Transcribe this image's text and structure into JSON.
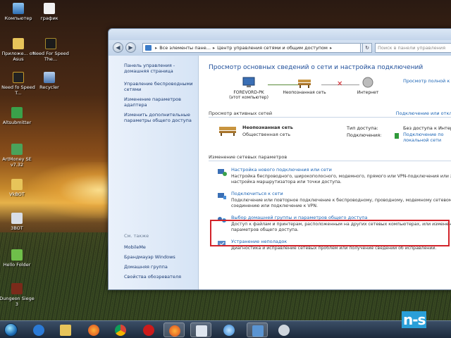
{
  "desktop": {
    "icons": [
      {
        "label": "Компьютер"
      },
      {
        "label": "график"
      },
      {
        "label": "Приложе... от Asus"
      },
      {
        "label": "Need For Speed The..."
      },
      {
        "label": "Need fo Speed T..."
      },
      {
        "label": "Recycler"
      },
      {
        "label": "Altsubmitter"
      },
      {
        "label": "ArtMoney SE v7.32"
      },
      {
        "label": "VkBOT"
      },
      {
        "label": "3BOT"
      },
      {
        "label": "Hello Folder"
      },
      {
        "label": "Dungeon Siege 3"
      }
    ]
  },
  "window": {
    "address": {
      "crumb1": "Все элементы пане...",
      "crumb2": "Центр управления сетями и общим доступом",
      "search_placeholder": "Поиск в панели управления"
    },
    "sidebar": {
      "links": [
        "Панель управления - домашняя страница",
        "Управление беспроводными сетями",
        "Изменение параметров адаптера",
        "Изменить дополнительные параметры общего доступа"
      ],
      "see_also_title": "См. также",
      "see_also": [
        "MobileMe",
        "Брандмауэр Windows",
        "Домашняя группа",
        "Свойства обозревателя"
      ]
    },
    "main": {
      "title": "Просмотр основных сведений о сети и настройка подключений",
      "full_map": "Просмотр полной к",
      "nodes": {
        "computer": "FOREVORD-PK",
        "computer_sub": "(этот компьютер)",
        "network": "Неопознанная сеть",
        "internet": "Интернет"
      },
      "active_section": "Просмотр активных сетей",
      "connect_disconnect": "Подключение или отклю",
      "active_net": {
        "name": "Неопознанная сеть",
        "type": "Общественная сеть",
        "access_type_label": "Тип доступа:",
        "access_type_value": "Без доступа к Интер",
        "connections_label": "Подключения:",
        "connection_value": "Подключение по локальной сети"
      },
      "change_section": "Изменение сетевых параметров",
      "tasks": [
        {
          "title": "Настройка нового подключения или сети",
          "desc": "Настройка беспроводного, широкополосного, модемного, прямого или VPN-подключения или же настройка маршрутизатора или точки доступа."
        },
        {
          "title": "Подключиться к сети",
          "desc": "Подключение или повторное подключение к беспроводному, проводному, модемному сетевому соединению или подключение к VPN."
        },
        {
          "title": "Выбор домашней группы и параметров общего доступа",
          "desc": "Доступ к файлам и принтерам, расположенным на других сетевых компьютерах, или изменение параметров общего доступа."
        },
        {
          "title": "Устранение неполадок",
          "desc": "Диагностика и исправление сетевых проблем или получение сведений об исправлении."
        }
      ]
    }
  },
  "logo_text": "n-s"
}
